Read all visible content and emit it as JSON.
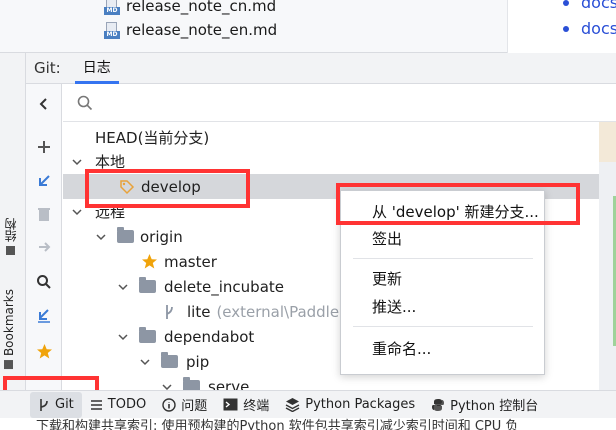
{
  "file_tree": {
    "files": [
      {
        "name": "release_note_cn.md",
        "icon_label": "MD"
      },
      {
        "name": "release_note_en.md",
        "icon_label": "MD"
      }
    ]
  },
  "docs_panel": {
    "items": [
      "docs",
      "docs"
    ]
  },
  "git_window": {
    "title": "Git:",
    "tabs": [
      {
        "label": "日志",
        "active": true
      }
    ]
  },
  "left_stripe": {
    "labels": [
      "结构",
      "Bookmarks"
    ]
  },
  "branches": {
    "head": "HEAD(当前分支)",
    "local_group": "本地",
    "local_branches": [
      "develop"
    ],
    "remote_group": "远程",
    "remotes": [
      {
        "name": "origin",
        "children": [
          {
            "name": "master",
            "favorite": true
          },
          {
            "name": "delete_incubate",
            "folder": true,
            "children": [
              {
                "name": "lite",
                "note": "(external\\Paddle, c"
              }
            ]
          },
          {
            "name": "dependabot",
            "folder": true,
            "children": [
              {
                "name": "pip",
                "folder": true,
                "children": [
                  {
                    "name": "serve",
                    "folder": true
                  }
                ]
              }
            ]
          }
        ]
      }
    ]
  },
  "context_menu": {
    "items": [
      {
        "label": "从 'develop' 新建分支..."
      },
      {
        "label": "签出"
      },
      {
        "label": "更新"
      },
      {
        "label": "推送..."
      },
      {
        "label": "重命名..."
      }
    ]
  },
  "bottom_bar": {
    "items": [
      {
        "label": "Git",
        "icon": "branch-icon",
        "active": true
      },
      {
        "label": "TODO",
        "icon": "list-icon"
      },
      {
        "label": "问题",
        "icon": "info-icon"
      },
      {
        "label": "终端",
        "icon": "terminal-icon"
      },
      {
        "label": "Python Packages",
        "icon": "layers-icon"
      },
      {
        "label": "Python 控制台",
        "icon": "python-icon"
      }
    ]
  },
  "status_line": "下载和构建共享索引: 使用预构建的Python 软件包共享索引减少索引时间和 CPU 负",
  "colors": {
    "accent": "#3574f0",
    "highlight_box": "#ff3333",
    "selected_row": "#d5d7db",
    "favorite_star": "#f0a30a"
  }
}
